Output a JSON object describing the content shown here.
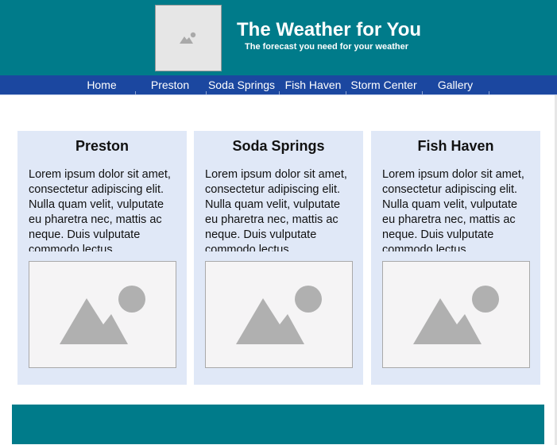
{
  "header": {
    "logo_icon": "image-placeholder-icon",
    "title": "The Weather for You",
    "subtitle": "The forecast you need for your weather"
  },
  "nav": {
    "items": [
      {
        "label": "Home"
      },
      {
        "label": "Preston"
      },
      {
        "label": "Soda Springs"
      },
      {
        "label": "Fish Haven"
      },
      {
        "label": "Storm Center"
      },
      {
        "label": "Gallery"
      }
    ]
  },
  "cards": [
    {
      "title": "Preston",
      "text": "Lorem ipsum dolor sit amet, consectetur adipiscing elit. Nulla quam velit, vulputate eu pharetra nec, mattis ac neque. Duis vulputate commodo lectus",
      "image_icon": "image-placeholder-icon"
    },
    {
      "title": "Soda Springs",
      "text": "Lorem ipsum dolor sit amet, consectetur adipiscing elit. Nulla quam velit, vulputate eu pharetra nec, mattis ac neque. Duis vulputate commodo lectus",
      "image_icon": "image-placeholder-icon"
    },
    {
      "title": "Fish Haven",
      "text": "Lorem ipsum dolor sit amet, consectetur adipiscing elit. Nulla quam velit, vulputate eu pharetra nec, mattis ac neque. Duis vulputate commodo lectus",
      "image_icon": "image-placeholder-icon"
    }
  ],
  "colors": {
    "header_bg": "#007b8a",
    "nav_bg": "#1b47a0",
    "card_bg": "#e0e8f7",
    "footer_bg": "#007b8a"
  }
}
